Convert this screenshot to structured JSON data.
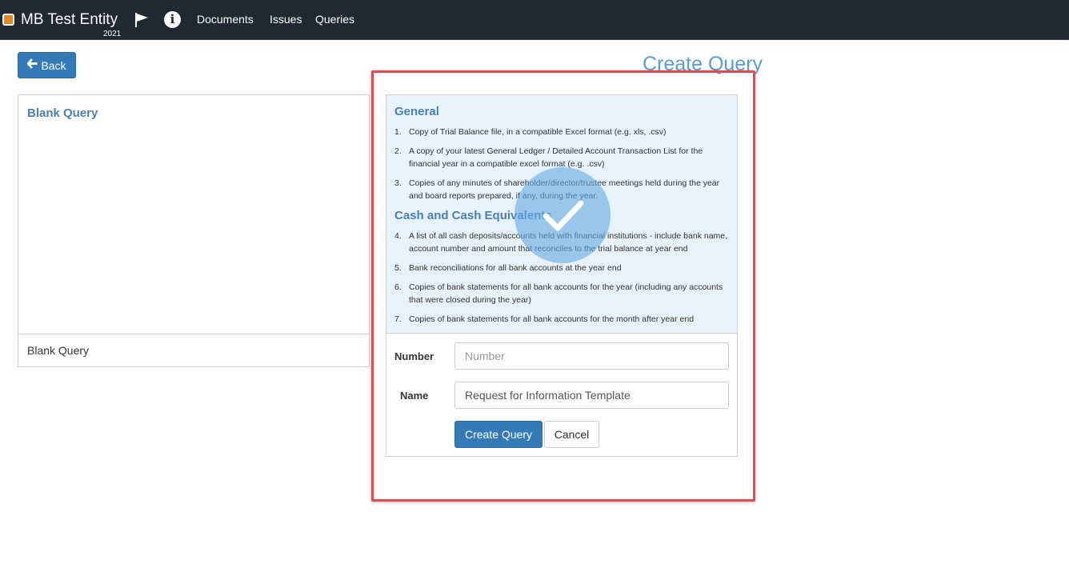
{
  "header": {
    "entity_name": "MB Test Entity",
    "entity_year": "2021",
    "brand_color": "#e8861a",
    "icons": [
      "flag-icon",
      "info-icon"
    ],
    "info_glyph": "i",
    "nav": [
      {
        "label": "Documents"
      },
      {
        "label": "Issues"
      },
      {
        "label": "Queries"
      }
    ]
  },
  "toolbar": {
    "back_label": "Back",
    "page_title": "Create Query"
  },
  "left_panel": {
    "title": "Blank Query",
    "footer": "Blank Query"
  },
  "template": {
    "sections": [
      {
        "heading": "General",
        "items": [
          {
            "num": "1.",
            "text": "Copy of Trial Balance file, in a compatible Excel format (e.g. xls, .csv)"
          },
          {
            "num": "2.",
            "text": "A copy of your latest General Ledger / Detailed Account Transaction List for the financial year in a compatible excel format (e.g. .csv)"
          },
          {
            "num": "3.",
            "text": "Copies of any minutes of shareholder/director/trustee meetings held during the year and board reports prepared, if any, during the year."
          }
        ]
      },
      {
        "heading": "Cash and Cash Equivalents",
        "items": [
          {
            "num": "4.",
            "text": "A list of all cash deposits/accounts held with financial institutions - include bank name, account number and amount that reconciles to the trial balance at year end"
          },
          {
            "num": "5.",
            "text": "Bank reconciliations for all bank accounts at the year end"
          },
          {
            "num": "6.",
            "text": "Copies of bank statements for all bank accounts for the year (including any accounts that were closed during the year)"
          },
          {
            "num": "7.",
            "text": "Copies of bank statements for all bank accounts for the month after year end"
          }
        ]
      }
    ],
    "selected_icon": "checkmark-icon"
  },
  "form": {
    "number_label": "Number",
    "number_value": "",
    "number_placeholder": "Number",
    "name_label": "Name",
    "name_value": "Request for Information Template",
    "create_label": "Create Query",
    "cancel_label": "Cancel"
  },
  "colors": {
    "navbar": "#222831",
    "primary": "#337ab7",
    "title": "#5b9bd5",
    "highlight": "#e5484d",
    "preview_bg": "#e8f2fa"
  }
}
